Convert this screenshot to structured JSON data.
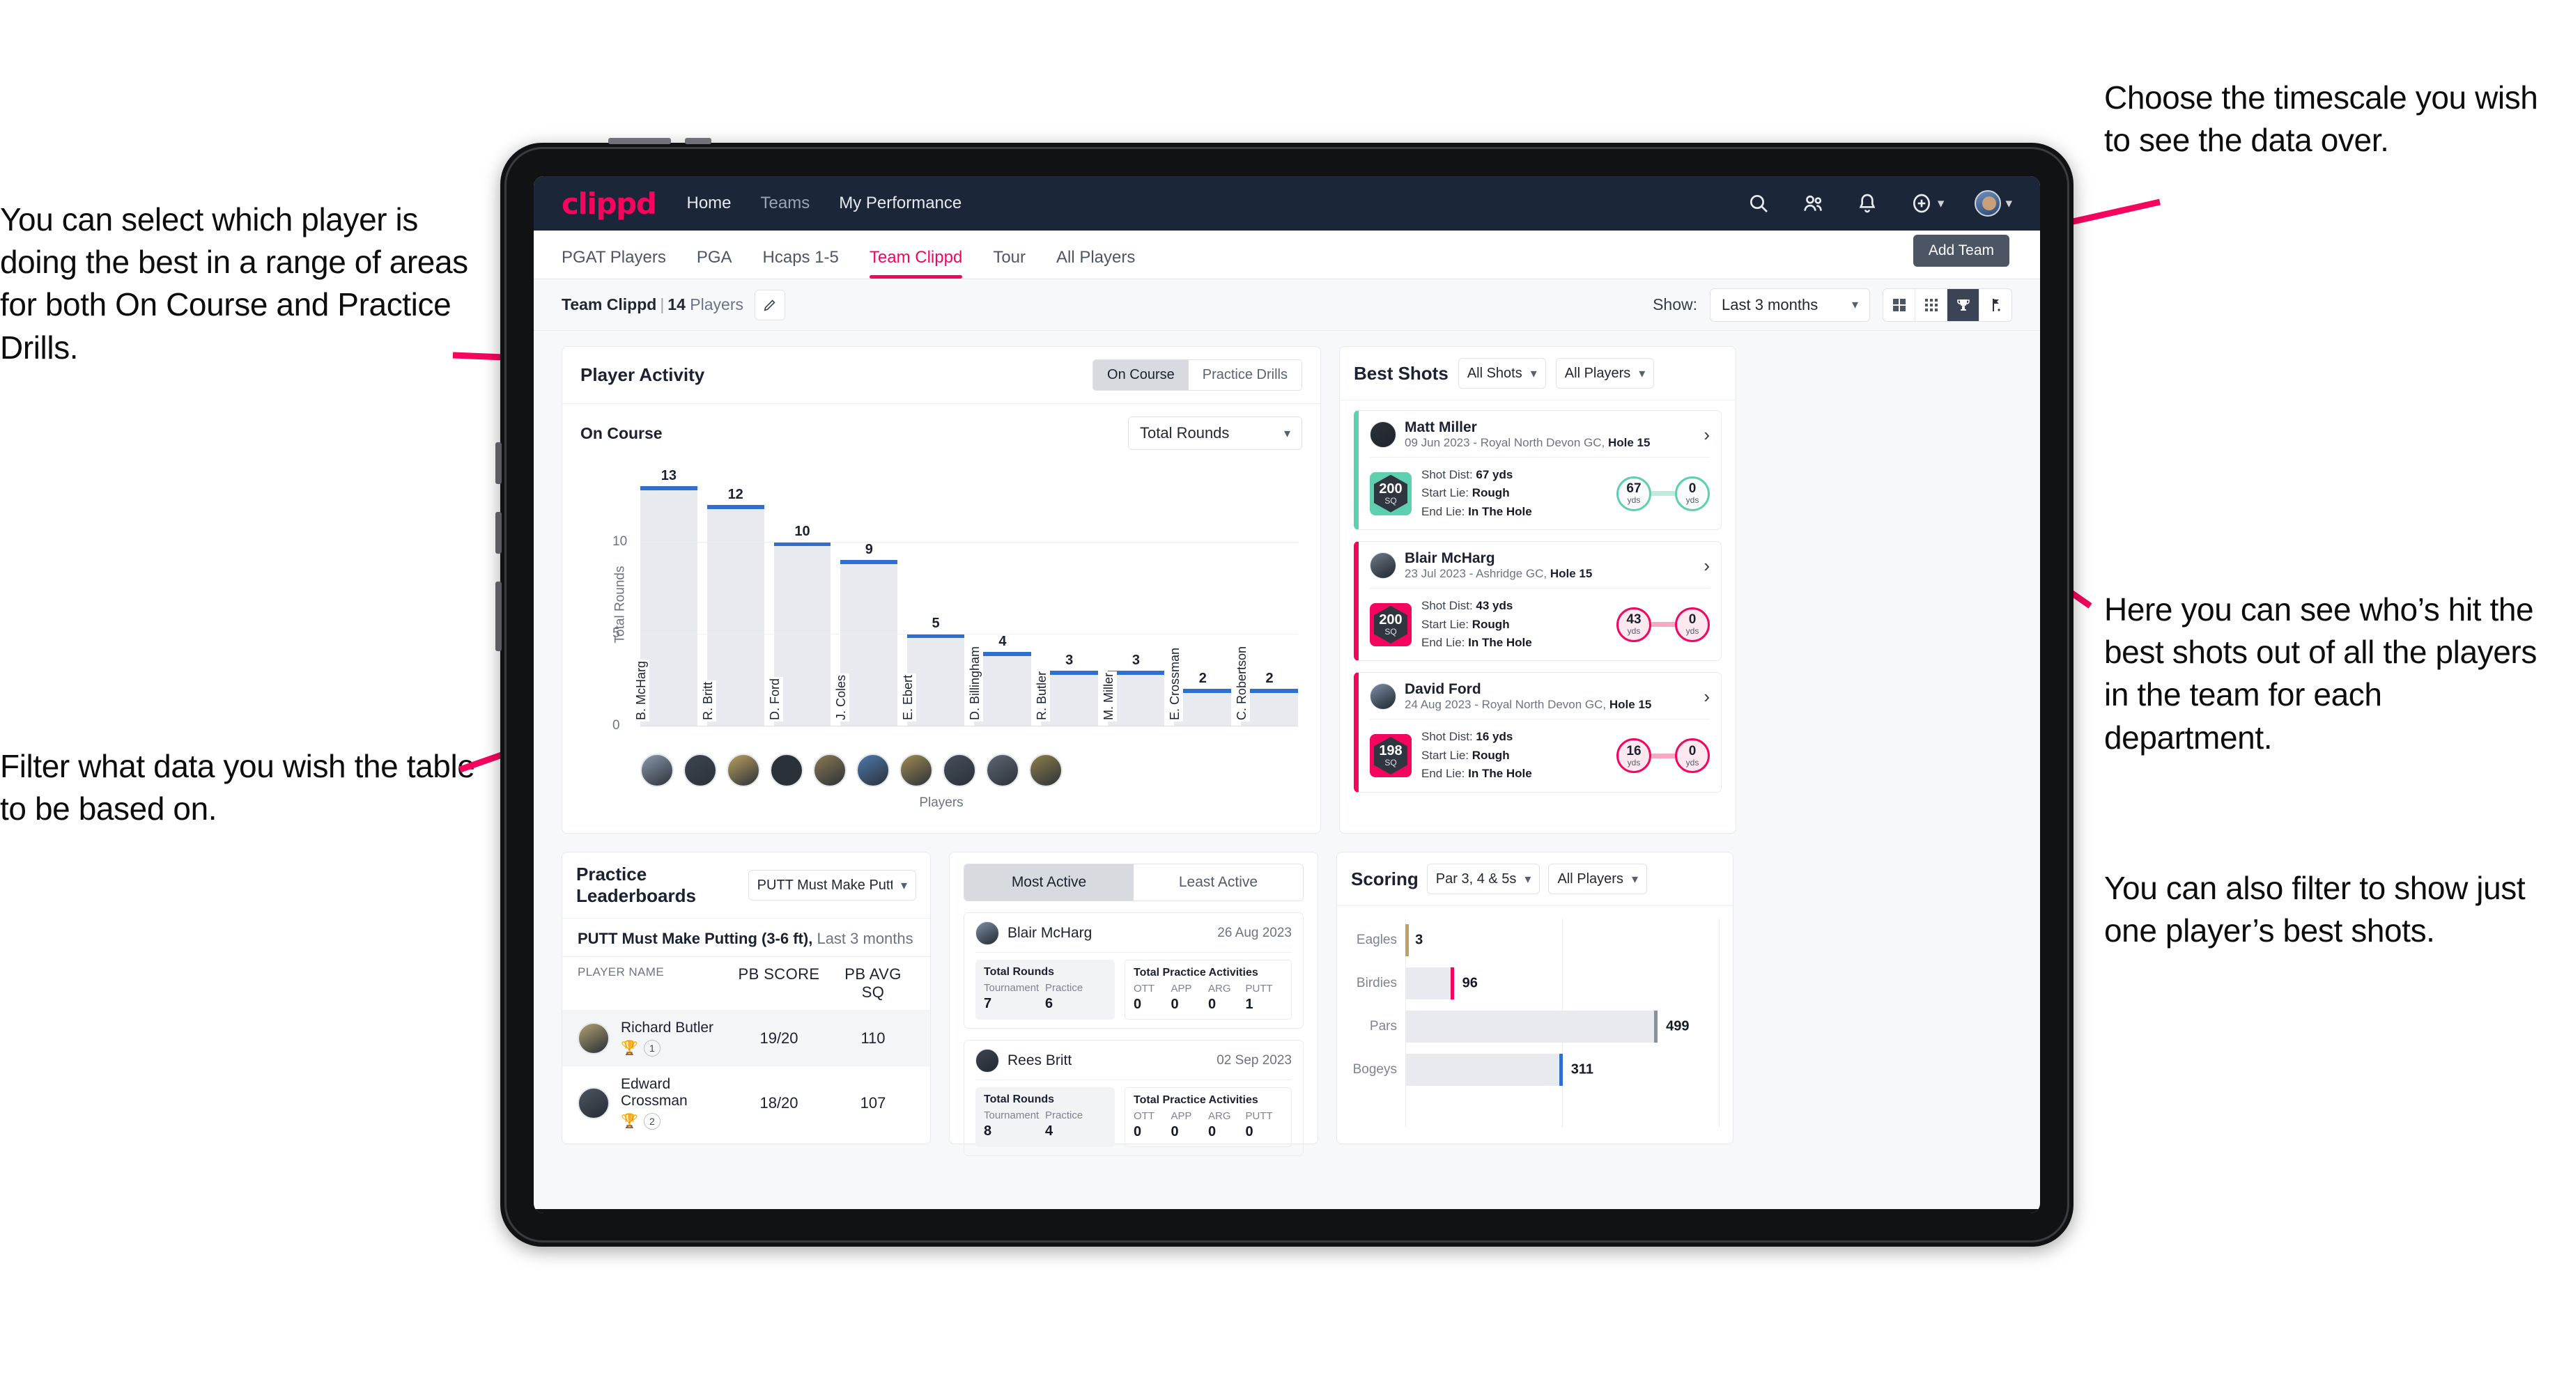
{
  "annotations": {
    "left_top": "You can select which player is doing the best in a range of areas for both On Course and Practice Drills.",
    "left_bottom": "Filter what data you wish the table to be based on.",
    "right_top": "Choose the timescale you wish to see the data over.",
    "right_mid": "Here you can see who’s hit the best shots out of all the players in the team for each department.",
    "right_bottom": "You can also filter to show just one player’s best shots."
  },
  "topnav": {
    "brand": "clippd",
    "links": [
      {
        "label": "Home",
        "active": true
      },
      {
        "label": "Teams",
        "active": false
      },
      {
        "label": "My Performance",
        "active": true
      }
    ],
    "icons": [
      "search-icon",
      "people-icon",
      "bell-icon",
      "plus-circle-icon",
      "avatar"
    ]
  },
  "tabs": [
    {
      "label": "PGAT Players",
      "active": false
    },
    {
      "label": "PGA",
      "active": false
    },
    {
      "label": "Hcaps 1-5",
      "active": false
    },
    {
      "label": "Team Clippd",
      "active": true
    },
    {
      "label": "Tour",
      "active": false
    },
    {
      "label": "All Players",
      "active": false
    }
  ],
  "tooltip": {
    "add_team": "Add Team"
  },
  "subbar": {
    "team_name": "Team Clippd",
    "separator": "|",
    "player_count": "14",
    "players_word": "Players",
    "edit_icon": "pencil-icon",
    "show_label": "Show:",
    "timescale_value": "Last 3 months",
    "view_icons": [
      "grid-large-icon",
      "grid-small-icon",
      "trophy-icon",
      "flag-icon"
    ],
    "active_view": "trophy-icon"
  },
  "player_activity": {
    "title": "Player Activity",
    "toggle": {
      "left": "On Course",
      "right": "Practice Drills",
      "active": "On Course"
    },
    "sub_label": "On Course",
    "metric_value": "Total Rounds"
  },
  "chart_data": [
    {
      "type": "bar",
      "title": "Player Activity",
      "xlabel": "Players",
      "ylabel": "Total Rounds",
      "categories": [
        "B. McHarg",
        "R. Britt",
        "D. Ford",
        "J. Coles",
        "E. Ebert",
        "D. Billingham",
        "R. Butler",
        "M. Miller",
        "E. Crossman",
        "C. Robertson"
      ],
      "values": [
        13,
        12,
        10,
        9,
        5,
        4,
        3,
        3,
        2,
        2
      ],
      "yticks": [
        0,
        5,
        10
      ],
      "ylim": [
        0,
        14
      ],
      "grid": true
    },
    {
      "type": "bar",
      "orientation": "horizontal",
      "title": "Scoring",
      "categories": [
        "Eagles",
        "Birdies",
        "Pars",
        "Bogeys"
      ],
      "values": [
        3,
        96,
        499,
        311
      ],
      "colors": [
        "#c0a062",
        "#f5055e",
        "#8b9199",
        "#2f6fd0"
      ],
      "xlim": [
        0,
        620
      ],
      "grid": true
    }
  ],
  "best_shots": {
    "title": "Best Shots",
    "filter_shots": "All Shots",
    "filter_players": "All Players",
    "cards": [
      {
        "player": "Matt Miller",
        "meta_date": "09 Jun 2023",
        "meta_course": "Royal North Devon GC,",
        "meta_hole": "Hole 15",
        "sq_value": "200",
        "sq_unit": "SQ",
        "accent": "#5ed0b0",
        "shot_dist_label": "Shot Dist:",
        "shot_dist": "67 yds",
        "start_lie_label": "Start Lie:",
        "start_lie": "Rough",
        "end_lie_label": "End Lie:",
        "end_lie": "In The Hole",
        "node_left": "67",
        "node_left_unit": "yds",
        "node_right": "0",
        "node_right_unit": "yds"
      },
      {
        "player": "Blair McHarg",
        "meta_date": "23 Jul 2023",
        "meta_course": "Ashridge GC,",
        "meta_hole": "Hole 15",
        "sq_value": "200",
        "sq_unit": "SQ",
        "accent": "#f5055e",
        "shot_dist_label": "Shot Dist:",
        "shot_dist": "43 yds",
        "start_lie_label": "Start Lie:",
        "start_lie": "Rough",
        "end_lie_label": "End Lie:",
        "end_lie": "In The Hole",
        "node_left": "43",
        "node_left_unit": "yds",
        "node_right": "0",
        "node_right_unit": "yds"
      },
      {
        "player": "David Ford",
        "meta_date": "24 Aug 2023",
        "meta_course": "Royal North Devon GC,",
        "meta_hole": "Hole 15",
        "sq_value": "198",
        "sq_unit": "SQ",
        "accent": "#f5055e",
        "shot_dist_label": "Shot Dist:",
        "shot_dist": "16 yds",
        "start_lie_label": "Start Lie:",
        "start_lie": "Rough",
        "end_lie_label": "End Lie:",
        "end_lie": "In The Hole",
        "node_left": "16",
        "node_left_unit": "yds",
        "node_right": "0",
        "node_right_unit": "yds"
      }
    ]
  },
  "practice_leaderboards": {
    "title": "Practice Leaderboards",
    "drill_select": "PUTT Must Make Putting ...",
    "subtitle_bold": "PUTT Must Make Putting (3-6 ft),",
    "subtitle_rest": "Last 3 months",
    "columns": [
      "PLAYER NAME",
      "PB SCORE",
      "PB AVG SQ"
    ],
    "rows": [
      {
        "name": "Richard Butler",
        "rank": "1",
        "trophy": "gold",
        "pb_score": "19/20",
        "pb_avg_sq": "110"
      },
      {
        "name": "Edward Crossman",
        "rank": "2",
        "trophy": "silver",
        "pb_score": "18/20",
        "pb_avg_sq": "107"
      }
    ]
  },
  "activity_panel": {
    "tabs": [
      {
        "label": "Most Active",
        "active": true
      },
      {
        "label": "Least Active",
        "active": false
      }
    ],
    "cards": [
      {
        "player": "Blair McHarg",
        "date": "26 Aug 2023",
        "rounds_title": "Total Rounds",
        "rounds_keys": [
          "Tournament",
          "Practice"
        ],
        "rounds_values": [
          "7",
          "6"
        ],
        "practice_title": "Total Practice Activities",
        "practice_keys": [
          "OTT",
          "APP",
          "ARG",
          "PUTT"
        ],
        "practice_values": [
          "0",
          "0",
          "0",
          "1"
        ]
      },
      {
        "player": "Rees Britt",
        "date": "02 Sep 2023",
        "rounds_title": "Total Rounds",
        "rounds_keys": [
          "Tournament",
          "Practice"
        ],
        "rounds_values": [
          "8",
          "4"
        ],
        "practice_title": "Total Practice Activities",
        "practice_keys": [
          "OTT",
          "APP",
          "ARG",
          "PUTT"
        ],
        "practice_values": [
          "0",
          "0",
          "0",
          "0"
        ]
      }
    ]
  },
  "scoring": {
    "title": "Scoring",
    "filter_par": "Par 3, 4 & 5s",
    "filter_players": "All Players"
  },
  "colors": {
    "brand_pink": "#f5055e",
    "navy": "#1b2638",
    "bar_blue": "#2f6fd0",
    "teal": "#5ed0b0"
  }
}
